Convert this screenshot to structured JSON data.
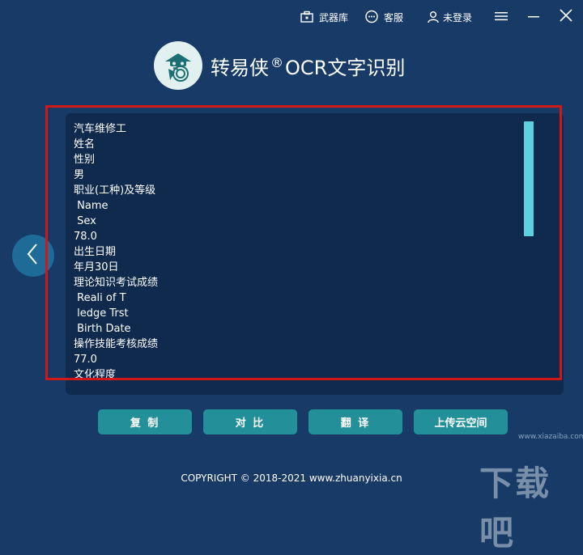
{
  "topbar": {
    "arsenal_label": "武器库",
    "service_label": "客服",
    "login_label": "未登录"
  },
  "brand": {
    "name": "转易侠",
    "registered": "®",
    "product": "OCR文字识别"
  },
  "ocr_result": {
    "lines": [
      "汽车维修工",
      "姓名",
      "性别",
      "男",
      "职业(工种)及等级",
      " Name",
      " Sex",
      "78.0",
      "出生日期",
      "年月30日",
      "理论知识考试成绩",
      " Reali of T",
      " ledge Trst",
      " Birth Date",
      "操作技能考核成绩",
      "77.0",
      "文化程度"
    ],
    "scroll_fraction": 0.0
  },
  "actions": {
    "copy_label": "复 制",
    "compare_label": "对 比",
    "translate_label": "翻 译",
    "upload_label": "上传云空间"
  },
  "footer": {
    "copyright": "COPYRIGHT © 2018-2021  www.zhuanyixia.cn"
  },
  "watermark": {
    "text": "下载吧",
    "url": "www.xiazaiba.com"
  },
  "colors": {
    "background": "#173a66",
    "panel": "#0f2a4d",
    "accent_button": "#238f99",
    "scroll_thumb": "#5fd0e0",
    "highlight": "#d01818"
  }
}
